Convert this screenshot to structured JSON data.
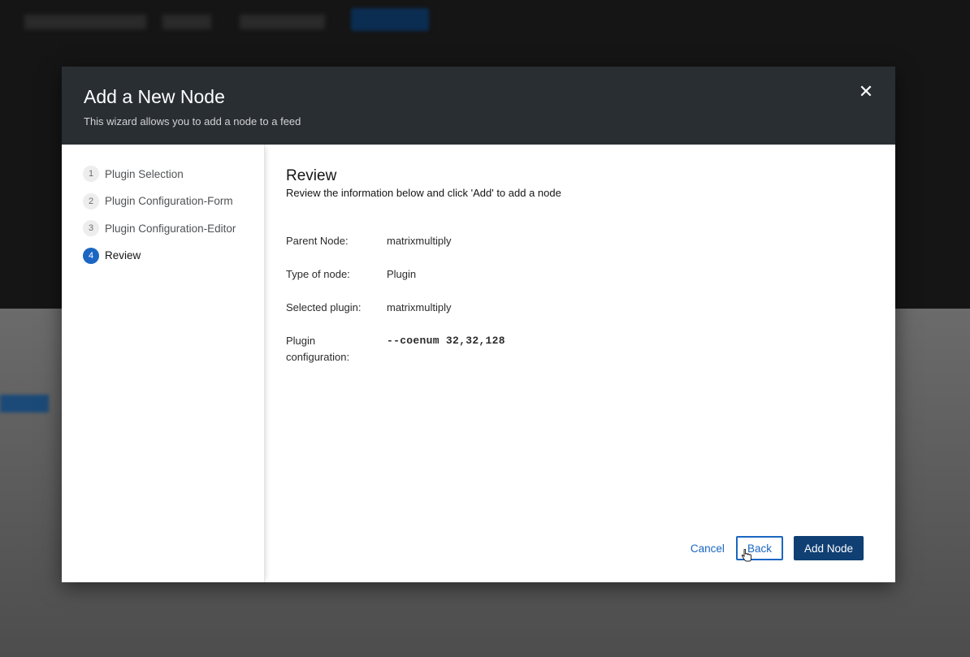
{
  "modal": {
    "title": "Add a New Node",
    "description": "This wizard allows you to add a node to a feed",
    "close_symbol": "✕"
  },
  "wizard": {
    "steps": [
      {
        "number": "1",
        "label": "Plugin Selection"
      },
      {
        "number": "2",
        "label": "Plugin Configuration-Form"
      },
      {
        "number": "3",
        "label": "Plugin Configuration-Editor"
      },
      {
        "number": "4",
        "label": "Review"
      }
    ],
    "current_step": "4"
  },
  "review": {
    "title": "Review",
    "description": "Review the information below and click 'Add' to add a node",
    "rows": [
      {
        "key": "Parent Node:",
        "value": "matrixmultiply"
      },
      {
        "key": "Type of node:",
        "value": "Plugin"
      },
      {
        "key": "Selected plugin:",
        "value": "matrixmultiply"
      },
      {
        "key": "Plugin configuration:",
        "value": "--coenum 32,32,128"
      }
    ]
  },
  "footer": {
    "cancel_label": "Cancel",
    "back_label": "Back",
    "add_label": "Add Node"
  },
  "colors": {
    "header_bg": "#292e33",
    "accent": "#1a66c2",
    "primary_button": "#0f3f73"
  },
  "icons": {
    "close": "close-icon",
    "cursor": "hand-pointer-icon"
  }
}
